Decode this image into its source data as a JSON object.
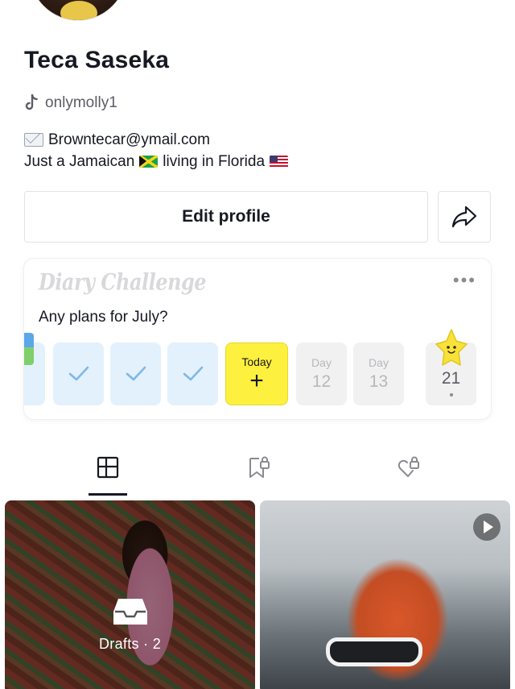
{
  "profile": {
    "name": "Teca Saseka",
    "handle": "onlymolly1",
    "email": "Browntecar@ymail.com",
    "bio_prefix": "Just a Jamaican",
    "bio_middle": "living in Florida"
  },
  "actions": {
    "edit_profile_label": "Edit profile"
  },
  "diary": {
    "title": "Diary Challenge",
    "prompt": "Any plans for July?",
    "more_icon": "more-dots-icon",
    "days": [
      {
        "state": "done"
      },
      {
        "state": "done"
      },
      {
        "state": "done"
      },
      {
        "state": "today",
        "label": "Today",
        "symbol": "+"
      },
      {
        "state": "future",
        "label": "Day",
        "number": "12"
      },
      {
        "state": "future",
        "label": "Day",
        "number": "13"
      },
      {
        "state": "goal",
        "number": "21"
      }
    ]
  },
  "tabs": [
    {
      "name": "videos",
      "icon": "grid-icon",
      "active": true
    },
    {
      "name": "favorites",
      "icon": "bookmark-lock-icon",
      "active": false
    },
    {
      "name": "liked",
      "icon": "heart-lock-icon",
      "active": false
    }
  ],
  "grid": {
    "drafts_label": "Drafts",
    "drafts_count": "· 2"
  },
  "colors": {
    "text": "#161823",
    "muted": "#5c5c66",
    "today_yellow": "#fef03e",
    "done_blue": "#e3f1fc",
    "check_blue": "#7fb8e6"
  }
}
